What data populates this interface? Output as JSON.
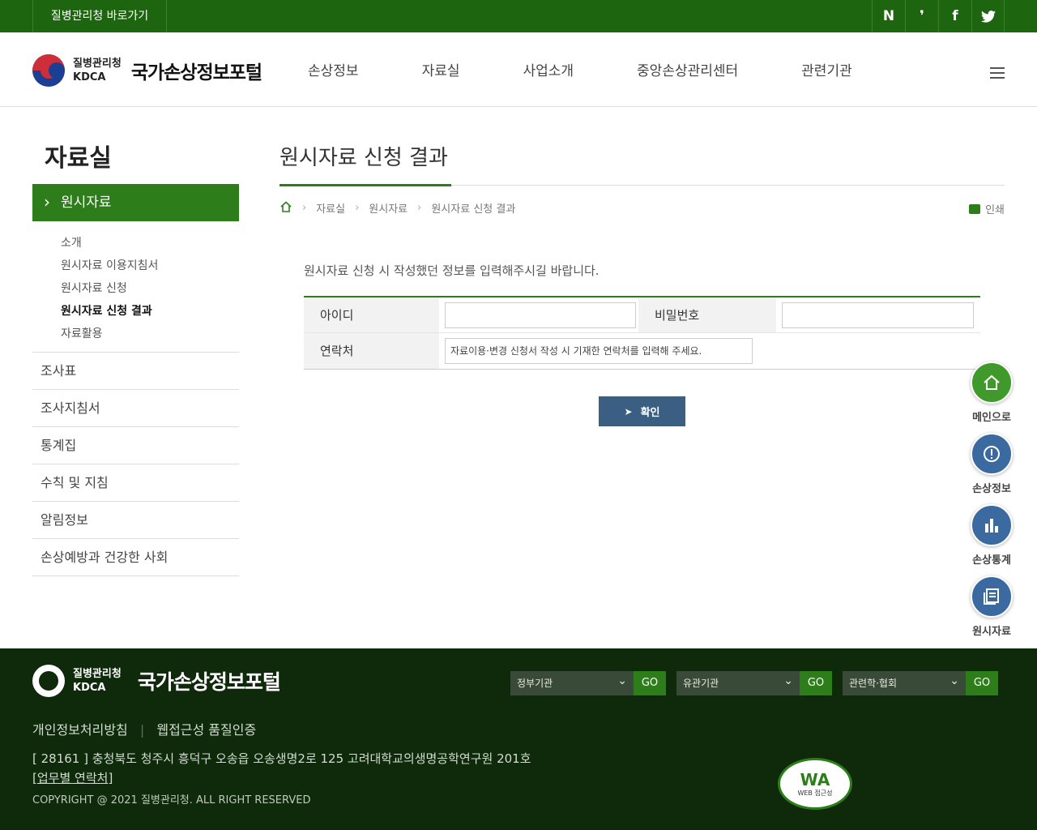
{
  "topbar": {
    "shortcut": "질병관리청 바로가기",
    "social": [
      "N",
      "❜",
      "f",
      "🐦"
    ]
  },
  "header": {
    "org_ko": "질병관리청",
    "org_en": "KDCA",
    "site_title": "국가손상정보포털",
    "nav": [
      "손상정보",
      "자료실",
      "사업소개",
      "중앙손상관리센터",
      "관련기관"
    ]
  },
  "sidebar": {
    "title": "자료실",
    "active": "원시자료",
    "sub_items": [
      "소개",
      "원시자료 이용지침서",
      "원시자료 신청",
      "원시자료 신청 결과",
      "자료활용"
    ],
    "current_sub": "원시자료 신청 결과",
    "items": [
      "조사표",
      "조사지침서",
      "통계집",
      "수칙 및 지침",
      "알림정보",
      "손상예방과 건강한 사회"
    ]
  },
  "content": {
    "title": "원시자료 신청 결과",
    "breadcrumb": [
      "자료실",
      "원시자료",
      "원시자료 신청 결과"
    ],
    "print_label": "인쇄",
    "guide": "원시자료 신청 시 작성했던 정보를 입력해주시길 바랍니다.",
    "form": {
      "id_label": "아이디",
      "id_value": "",
      "pw_label": "비밀번호",
      "pw_value": "",
      "contact_label": "연락처",
      "contact_placeholder": "자료이용·변경 신청서 작성 시 기재한 연락처를 입력해 주세요."
    },
    "confirm_label": "확인"
  },
  "quick_menu": [
    {
      "label": "메인으로",
      "icon": "home-icon",
      "color": "#3f9a2b"
    },
    {
      "label": "손상정보",
      "icon": "alert-icon",
      "color": "#3b6aa0"
    },
    {
      "label": "손상통계",
      "icon": "bar-chart-icon",
      "color": "#3b6aa0"
    },
    {
      "label": "원시자료",
      "icon": "document-icon",
      "color": "#3b6aa0"
    }
  ],
  "footer": {
    "org_ko": "질병관리청",
    "org_en": "KDCA",
    "site_title": "국가손상정보포털",
    "selects": [
      {
        "value": "정부기관",
        "go": "GO"
      },
      {
        "value": "유관기관",
        "go": "GO"
      },
      {
        "value": "관련학·협회",
        "go": "GO"
      }
    ],
    "links": [
      "개인정보처리방침",
      "웹접근성 품질인증"
    ],
    "address": "[ 28161 ] 충청북도 청주시 흥덕구 오송읍 오송생명2로 125 고려대학교의생명공학연구원 201호",
    "contact": "업무별 연락처",
    "copyright": "COPYRIGHT @ 2021 질병관리청. ALL RIGHT RESERVED",
    "wa_mark": "WA",
    "wa_sub": "WEB 접근성"
  }
}
